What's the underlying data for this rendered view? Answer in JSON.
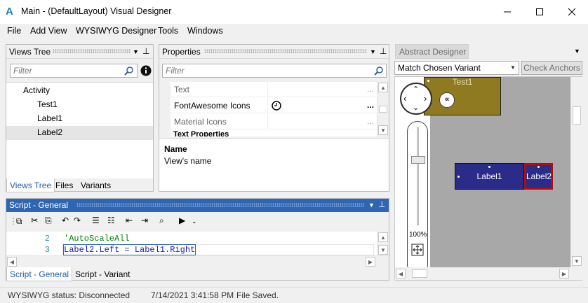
{
  "window": {
    "title": "Main - (DefaultLayout) Visual Designer",
    "app_icon": "A"
  },
  "menu": {
    "items": [
      "File",
      "Add View",
      "WYSIWYG Designer",
      "Tools",
      "Windows"
    ]
  },
  "views_tree": {
    "title": "Views Tree",
    "filter_placeholder": "Filter",
    "items": [
      "Activity",
      "Test1",
      "Label1",
      "Label2"
    ],
    "selected": "Label2",
    "tabs": [
      "Views Tree",
      "Files",
      "Variants"
    ]
  },
  "properties": {
    "title": "Properties",
    "filter_placeholder": "Filter",
    "rows": [
      {
        "name": "Text",
        "value": "",
        "button": "..."
      },
      {
        "name": "FontAwesome Icons",
        "value": "",
        "button": "..."
      },
      {
        "name": "Material Icons",
        "value": "",
        "button": "..."
      }
    ],
    "section": "Text Properties",
    "desc_title": "Name",
    "desc_text": "View's name"
  },
  "script": {
    "title": "Script - General",
    "lines": [
      {
        "num": "2",
        "text": "'AutoScaleAll"
      },
      {
        "num": "3",
        "text": "Label2.Left = Label1.Right"
      }
    ],
    "tabs": [
      "Script - General",
      "Script - Variant"
    ]
  },
  "abstract": {
    "title": "Abstract Designer",
    "variant_select": "Match Chosen Variant",
    "check_button": "Check Anchors",
    "zoom": "100%",
    "views": [
      {
        "label": "Test1"
      },
      {
        "label": "Label1"
      },
      {
        "label": "Label2"
      }
    ]
  },
  "status": {
    "wysiwyg": "WYSIWYG status: Disconnected",
    "time": "7/14/2021 3:41:58 PM",
    "message": "File Saved."
  },
  "colors": {
    "accent": "#2f66b3",
    "test1_bg": "#8f7a21",
    "label_bg": "#2b2c8a",
    "selected_border": "#b10d0d"
  }
}
